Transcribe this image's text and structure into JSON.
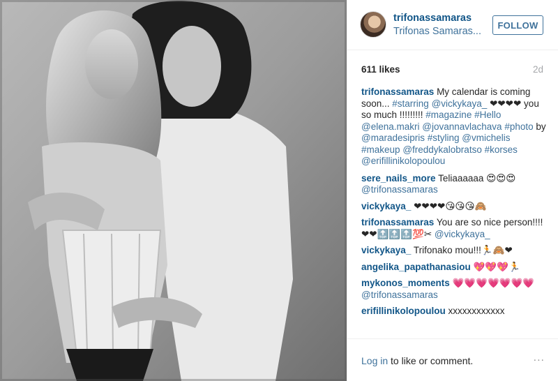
{
  "post": {
    "username": "trifonassamaras",
    "full_name": "Trifonas Samaras...",
    "follow_label": "FOLLOW",
    "likes": "611 likes",
    "age": "2d"
  },
  "caption": {
    "author": "trifonassamaras",
    "parts": [
      {
        "text": " My calendar is coming soon... ",
        "link": false
      },
      {
        "text": "#starring",
        "link": true
      },
      {
        "text": " ",
        "link": false
      },
      {
        "text": "@vickykaya_",
        "link": true
      },
      {
        "text": " ❤❤❤❤ you so much !!!!!!!!! ",
        "link": false
      },
      {
        "text": "#magazine",
        "link": true
      },
      {
        "text": " ",
        "link": false
      },
      {
        "text": "#Hello",
        "link": true
      },
      {
        "text": " ",
        "link": false
      },
      {
        "text": "@elena.makri",
        "link": true
      },
      {
        "text": " ",
        "link": false
      },
      {
        "text": "@jovannavlachava",
        "link": true
      },
      {
        "text": " ",
        "link": false
      },
      {
        "text": "#photo",
        "link": true
      },
      {
        "text": " by ",
        "link": false
      },
      {
        "text": "@maradesipris",
        "link": true
      },
      {
        "text": " ",
        "link": false
      },
      {
        "text": "#styling",
        "link": true
      },
      {
        "text": " ",
        "link": false
      },
      {
        "text": "@vmichelis",
        "link": true
      },
      {
        "text": " ",
        "link": false
      },
      {
        "text": "#makeup",
        "link": true
      },
      {
        "text": " ",
        "link": false
      },
      {
        "text": "@freddykalobratso",
        "link": true
      },
      {
        "text": " ",
        "link": false
      },
      {
        "text": "#korses",
        "link": true
      },
      {
        "text": " ",
        "link": false
      },
      {
        "text": "@erifillinikolopoulou",
        "link": true
      }
    ]
  },
  "comments": [
    {
      "author": "sere_nails_more",
      "parts": [
        {
          "text": " Teliaaaaaa 😍😍😍 ",
          "link": false
        },
        {
          "text": "@trifonassamaras",
          "link": true
        }
      ]
    },
    {
      "author": "vickykaya_",
      "parts": [
        {
          "text": " ❤❤❤❤😘😘😘🙈",
          "link": false
        }
      ]
    },
    {
      "author": "trifonassamaras",
      "parts": [
        {
          "text": " You are so nice person!!!! ❤❤🔝🔝🔝💯✂ ",
          "link": false
        },
        {
          "text": "@vickykaya_",
          "link": true
        }
      ]
    },
    {
      "author": "vickykaya_",
      "parts": [
        {
          "text": " Trifonako mou!!!🏃🙈❤",
          "link": false
        }
      ]
    },
    {
      "author": "angelika_papathanasiou",
      "parts": [
        {
          "text": " 💖💖💖🏃",
          "link": false
        }
      ]
    },
    {
      "author": "mykonos_moments",
      "parts": [
        {
          "text": " 💗💗💗💗💗💗💗 ",
          "link": false
        },
        {
          "text": "@trifonassamaras",
          "link": true
        }
      ]
    },
    {
      "author": "erifillinikolopoulou",
      "parts": [
        {
          "text": " xxxxxxxxxxxx",
          "link": false
        }
      ]
    }
  ],
  "footer": {
    "login_link": "Log in",
    "login_rest": " to like or comment.",
    "more_icon": "..."
  },
  "colors": {
    "link": "#3f729b",
    "author": "#125688",
    "text": "#262626",
    "muted": "#a5a7aa"
  }
}
